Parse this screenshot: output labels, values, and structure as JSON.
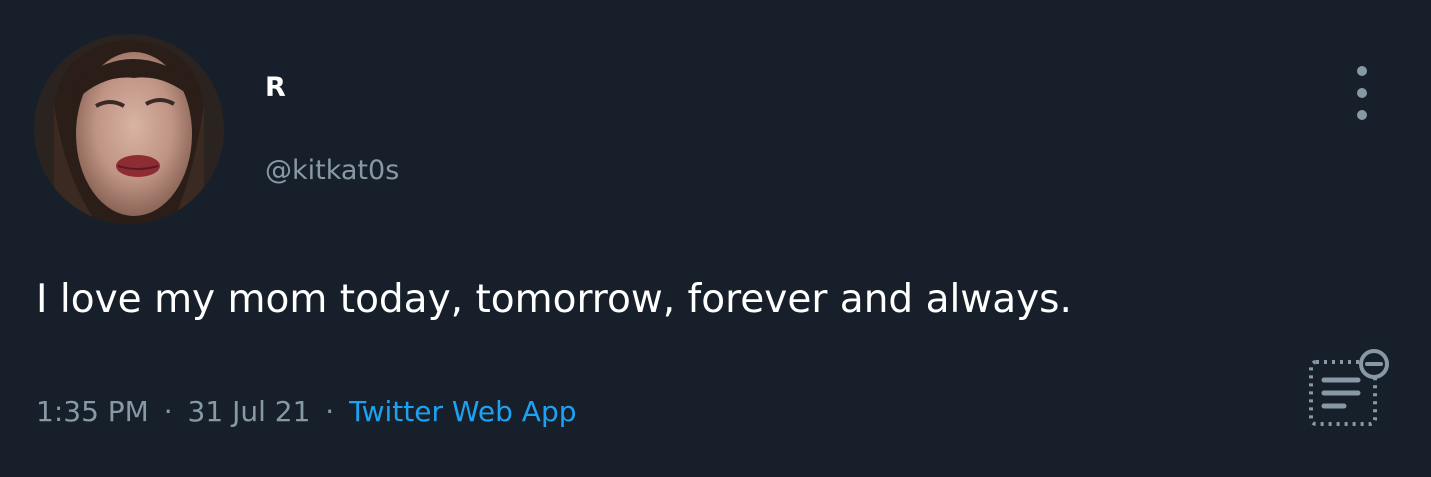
{
  "user": {
    "display_name": "R",
    "handle": "@kitkat0s"
  },
  "tweet": {
    "text": "I love my mom today, tomorrow, forever and always."
  },
  "meta": {
    "time": "1:35 PM",
    "date": "31 Jul 21",
    "separator": "·",
    "source": "Twitter Web App"
  },
  "colors": {
    "background": "#17202a",
    "primary_text": "#ffffff",
    "secondary_text": "#8899a6",
    "link": "#1da1f2"
  },
  "icons": {
    "more": "more-vertical-icon",
    "reader": "reader-mode-icon"
  }
}
